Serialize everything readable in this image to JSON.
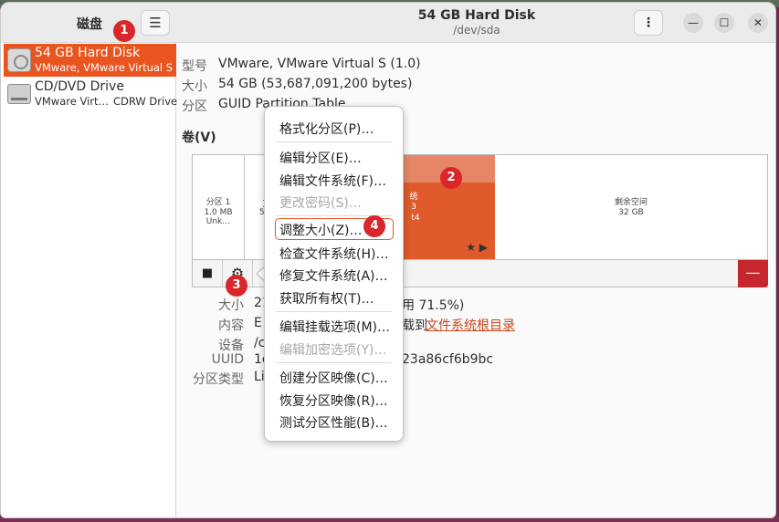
{
  "left_panel": {
    "title": "磁盘",
    "menu_icon": "hamburger-icon",
    "drives": [
      {
        "name": "54 GB Hard Disk",
        "subtitle": "VMware, VMware Virtual S",
        "icon": "hard-disk-icon"
      },
      {
        "name": "CD/DVD Drive",
        "subtitle": "VMware Virt…",
        "subtitle2": "CDRW Drive",
        "icon": "optical-drive-icon"
      }
    ]
  },
  "header": {
    "title": "54 GB Hard Disk",
    "subtitle": "/dev/sda",
    "kebab": "⋮",
    "minimize": "—",
    "maximize": "☐",
    "close": "✕"
  },
  "info": {
    "model_label": "型号",
    "model_value": "VMware, VMware Virtual S (1.0)",
    "size_label": "大小",
    "size_value": "54 GB (53,687,091,200 bytes)",
    "partition_label": "分区",
    "partition_value": "GUID Partition Table"
  },
  "volumes": {
    "heading": "卷(V)",
    "segments": [
      {
        "line1": "分区 1",
        "line2": "1.0 MB Unk…"
      },
      {
        "line1": "文",
        "line2": "538"
      },
      {
        "line1": "统",
        "line2": "3",
        "line3": "t4"
      },
      {
        "line1": "剩余空间",
        "line2": "32 GB"
      }
    ],
    "toolbar": {
      "stop": "■",
      "gear": "⚙",
      "minus": "—"
    }
  },
  "partition": {
    "size_label": "大小",
    "size_value": "21",
    "size_tail": "用 71.5%)",
    "content_label": "内容",
    "content_value": "E",
    "content_tail": "载到",
    "content_link": "文件系统根目录",
    "device_label": "设备",
    "device_value": "/c",
    "uuid_label": "UUID",
    "uuid_value": "1c",
    "uuid_tail": "23a86cf6b9bc",
    "type_label": "分区类型",
    "type_value": "Li"
  },
  "context_menu": {
    "items": [
      {
        "label": "格式化分区(P)…",
        "enabled": true
      },
      {
        "label": "编辑分区(E)…",
        "enabled": true
      },
      {
        "label": "编辑文件系统(F)…",
        "enabled": true
      },
      {
        "label": "更改密码(S)…",
        "enabled": false
      },
      {
        "label": "调整大小(Z)…",
        "enabled": true
      },
      {
        "label": "检查文件系统(H)…",
        "enabled": true
      },
      {
        "label": "修复文件系统(A)…",
        "enabled": true
      },
      {
        "label": "获取所有权(T)…",
        "enabled": true
      },
      {
        "label": "编辑挂载选项(M)…",
        "enabled": true
      },
      {
        "label": "编辑加密选项(Y)…",
        "enabled": false
      },
      {
        "label": "创建分区映像(C)…",
        "enabled": true
      },
      {
        "label": "恢复分区映像(R)…",
        "enabled": true
      },
      {
        "label": "测试分区性能(B)…",
        "enabled": true
      }
    ]
  },
  "annotations": [
    "1",
    "2",
    "3",
    "4"
  ],
  "colors": {
    "accent": "#e9541f",
    "danger": "#c6262e",
    "badge": "#d9262b"
  }
}
